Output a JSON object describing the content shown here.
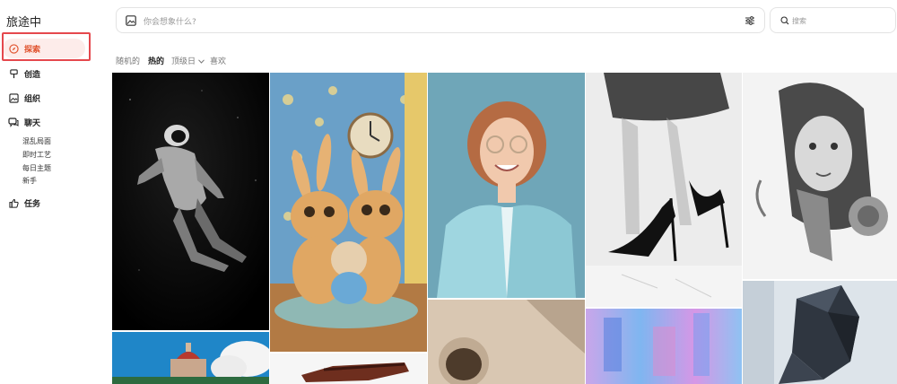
{
  "app": {
    "title": "旅途中"
  },
  "sidebar": {
    "items": [
      {
        "label": "探索",
        "icon": "compass-icon",
        "active": true
      },
      {
        "label": "创造",
        "icon": "brush-icon"
      },
      {
        "label": "组织",
        "icon": "image-icon"
      },
      {
        "label": "聊天",
        "icon": "chat-icon"
      },
      {
        "label": "任务",
        "icon": "thumbs-up-icon"
      }
    ],
    "chat_sub": [
      "混乱局面",
      "即时工艺",
      "每日主题",
      "新手"
    ]
  },
  "search": {
    "placeholder": "你会想象什么?",
    "side_placeholder": "搜索"
  },
  "filters": [
    {
      "label": "随机的"
    },
    {
      "label": "热的",
      "active": true
    },
    {
      "label": "顶级日"
    },
    {
      "label": "喜欢"
    }
  ],
  "gallery": {
    "items": [
      {
        "name": "astronaut-image"
      },
      {
        "name": "rabbits-image"
      },
      {
        "name": "smiling-woman-image"
      },
      {
        "name": "high-heels-image"
      },
      {
        "name": "tattoo-portrait-image"
      },
      {
        "name": "building-sky-image"
      },
      {
        "name": "food-image"
      },
      {
        "name": "shadow-wall-image"
      },
      {
        "name": "abstract-paint-image"
      },
      {
        "name": "low-poly-figure-image"
      }
    ]
  },
  "colors": {
    "accent": "#e0512c",
    "highlight_border": "#e5484d"
  }
}
